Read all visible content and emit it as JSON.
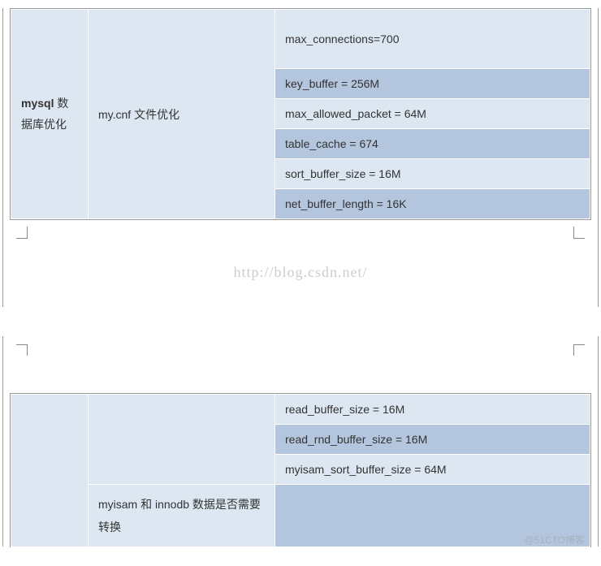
{
  "section1": {
    "title_bold": "mysql",
    "title_rest": "数据库优化",
    "subtitle": "my.cnf 文件优化",
    "rows": [
      {
        "value": "max_connections=700",
        "shade": "light"
      },
      {
        "value": "key_buffer = 256M",
        "shade": "dark"
      },
      {
        "value": "max_allowed_packet = 64M",
        "shade": "light"
      },
      {
        "value": "table_cache = 674",
        "shade": "dark"
      },
      {
        "value": "sort_buffer_size = 16M",
        "shade": "light"
      },
      {
        "value": "net_buffer_length = 16K",
        "shade": "dark"
      }
    ]
  },
  "watermark_csdn": "http://blog.csdn.net/",
  "section2": {
    "rows": [
      {
        "value": "read_buffer_size = 16M",
        "shade": "light"
      },
      {
        "value": "read_rnd_buffer_size = 16M",
        "shade": "dark"
      },
      {
        "value": "myisam_sort_buffer_size = 64M",
        "shade": "light"
      }
    ],
    "footer_sub": "myisam 和 innodb 数据是否需要转换"
  },
  "watermark_51cto": "@51CTO博客"
}
